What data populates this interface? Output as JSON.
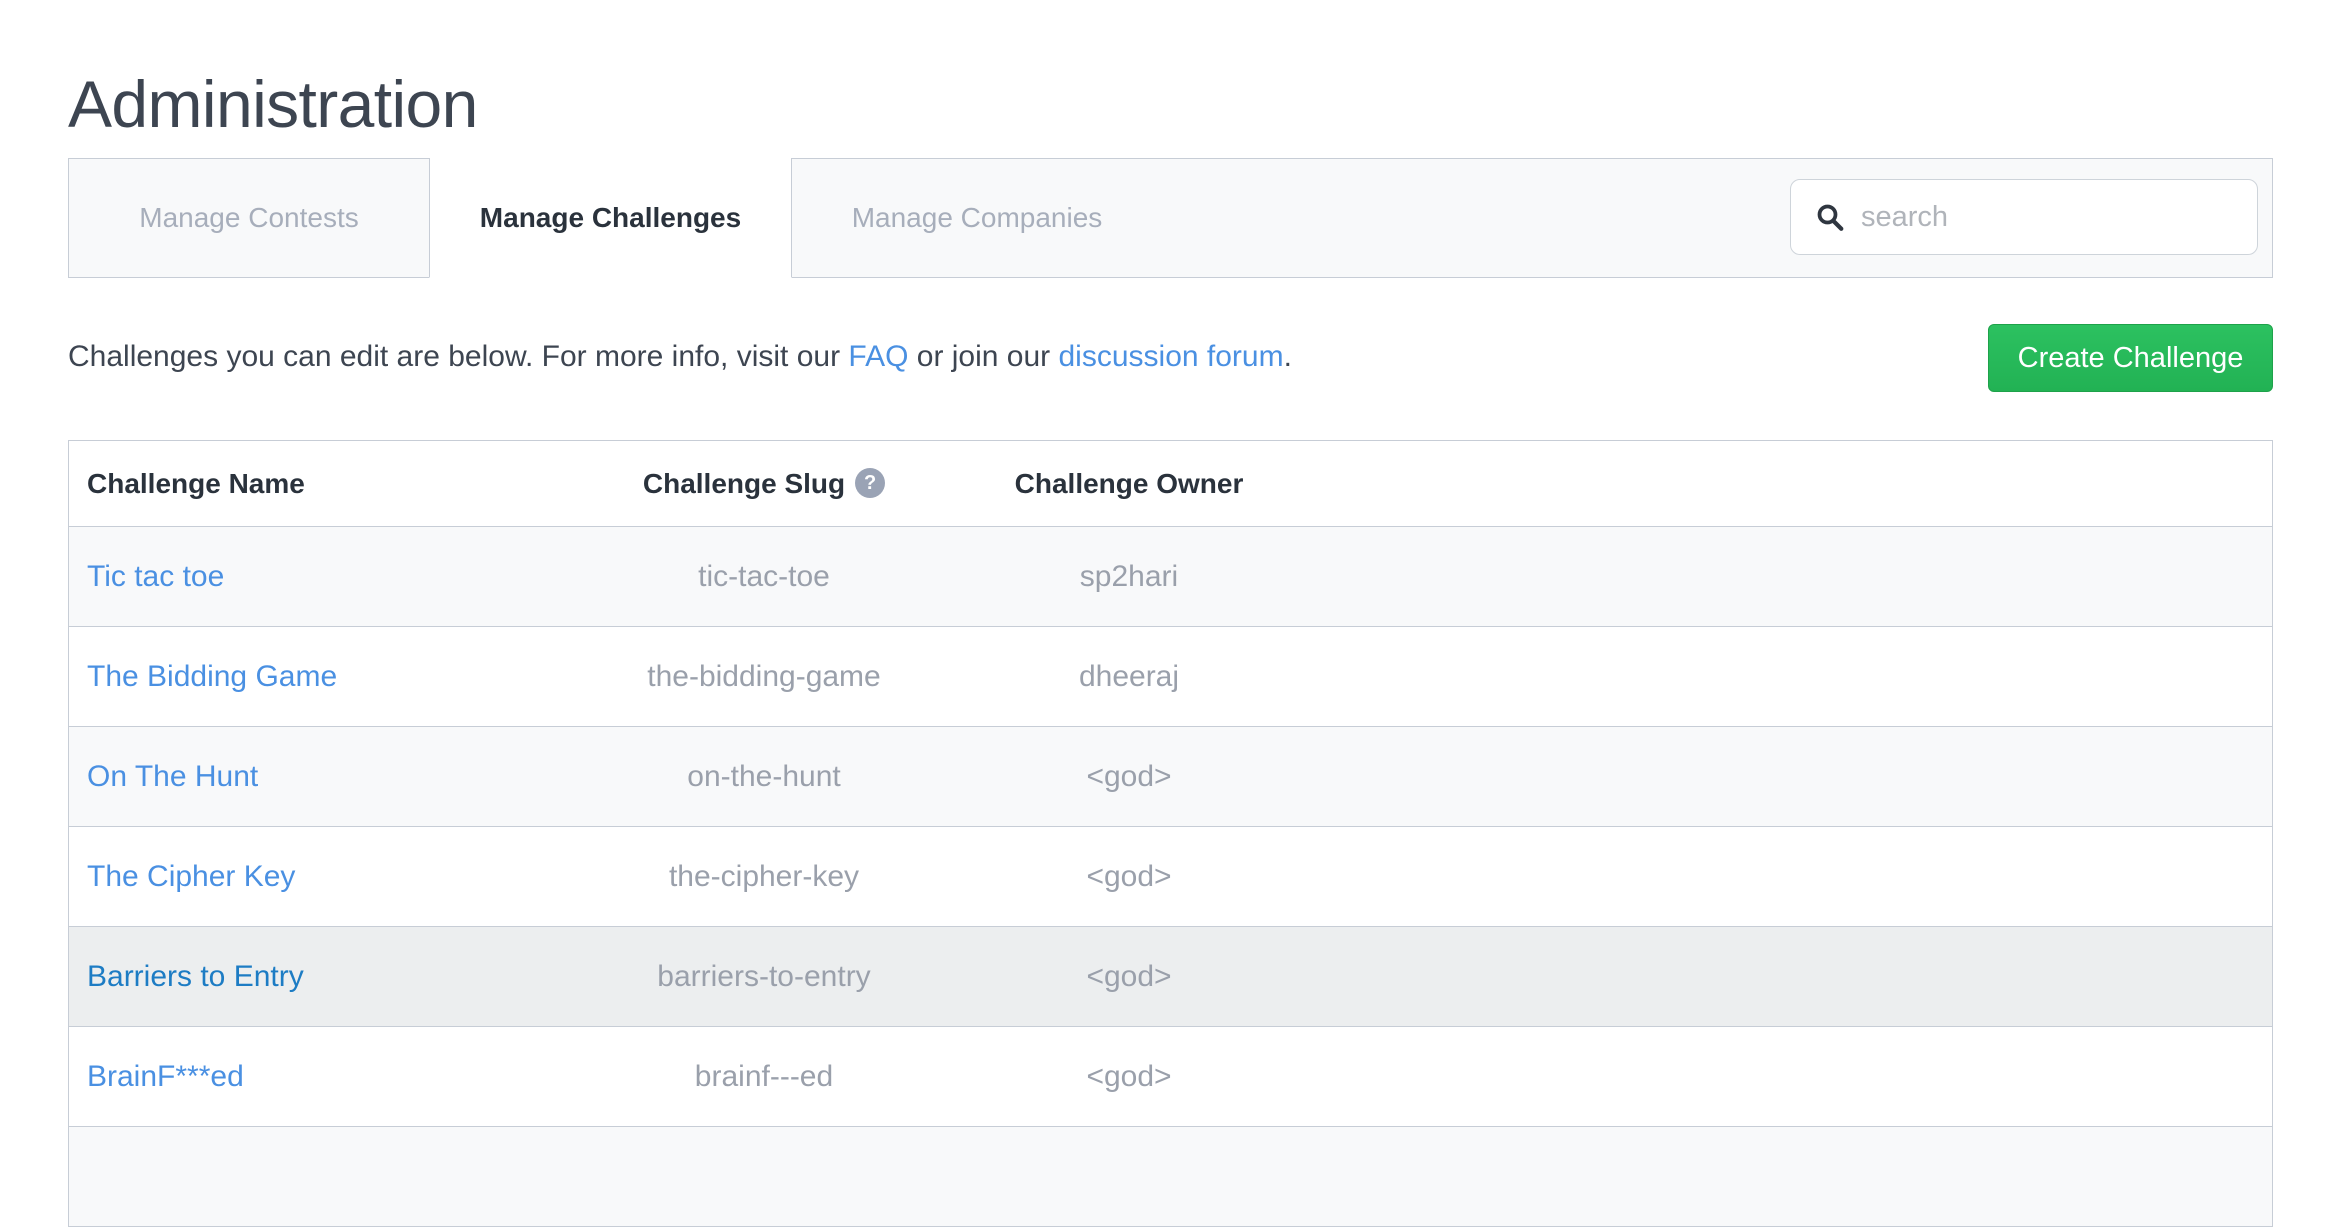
{
  "page": {
    "title": "Administration"
  },
  "tabs": [
    {
      "label": "Manage Contests",
      "active": false
    },
    {
      "label": "Manage Challenges",
      "active": true
    },
    {
      "label": "Manage Companies",
      "active": false
    }
  ],
  "search": {
    "placeholder": "search",
    "value": "",
    "icon": "search-icon"
  },
  "intro": {
    "text_before_faq": "Challenges you can edit are below. For more info, visit our ",
    "faq_link": "FAQ",
    "text_between": " or join our ",
    "forum_link": "discussion forum",
    "text_after": "."
  },
  "toolbar": {
    "create_label": "Create Challenge"
  },
  "table": {
    "columns": [
      {
        "label": "Challenge Name",
        "help": false
      },
      {
        "label": "Challenge Slug",
        "help": true,
        "help_glyph": "?"
      },
      {
        "label": "Challenge Owner",
        "help": false
      }
    ],
    "rows": [
      {
        "name": "Tic tac toe",
        "slug": "tic-tac-toe",
        "owner": "sp2hari"
      },
      {
        "name": "The Bidding Game",
        "slug": "the-bidding-game",
        "owner": "dheeraj"
      },
      {
        "name": "On The Hunt",
        "slug": "on-the-hunt",
        "owner": "<god>"
      },
      {
        "name": "The Cipher Key",
        "slug": "the-cipher-key",
        "owner": "<god>"
      },
      {
        "name": "Barriers to Entry",
        "slug": "barriers-to-entry",
        "owner": "<god>"
      },
      {
        "name": "BrainF***ed",
        "slug": "brainf---ed",
        "owner": "<god>"
      }
    ]
  },
  "colors": {
    "link": "#4a90e2",
    "accent_green": "#22b254",
    "text_dark": "#3d4551",
    "text_muted": "#9aa0ab",
    "border": "#c7cdd6",
    "stripe": "#f8f9fa",
    "hover": "#eceeef"
  }
}
